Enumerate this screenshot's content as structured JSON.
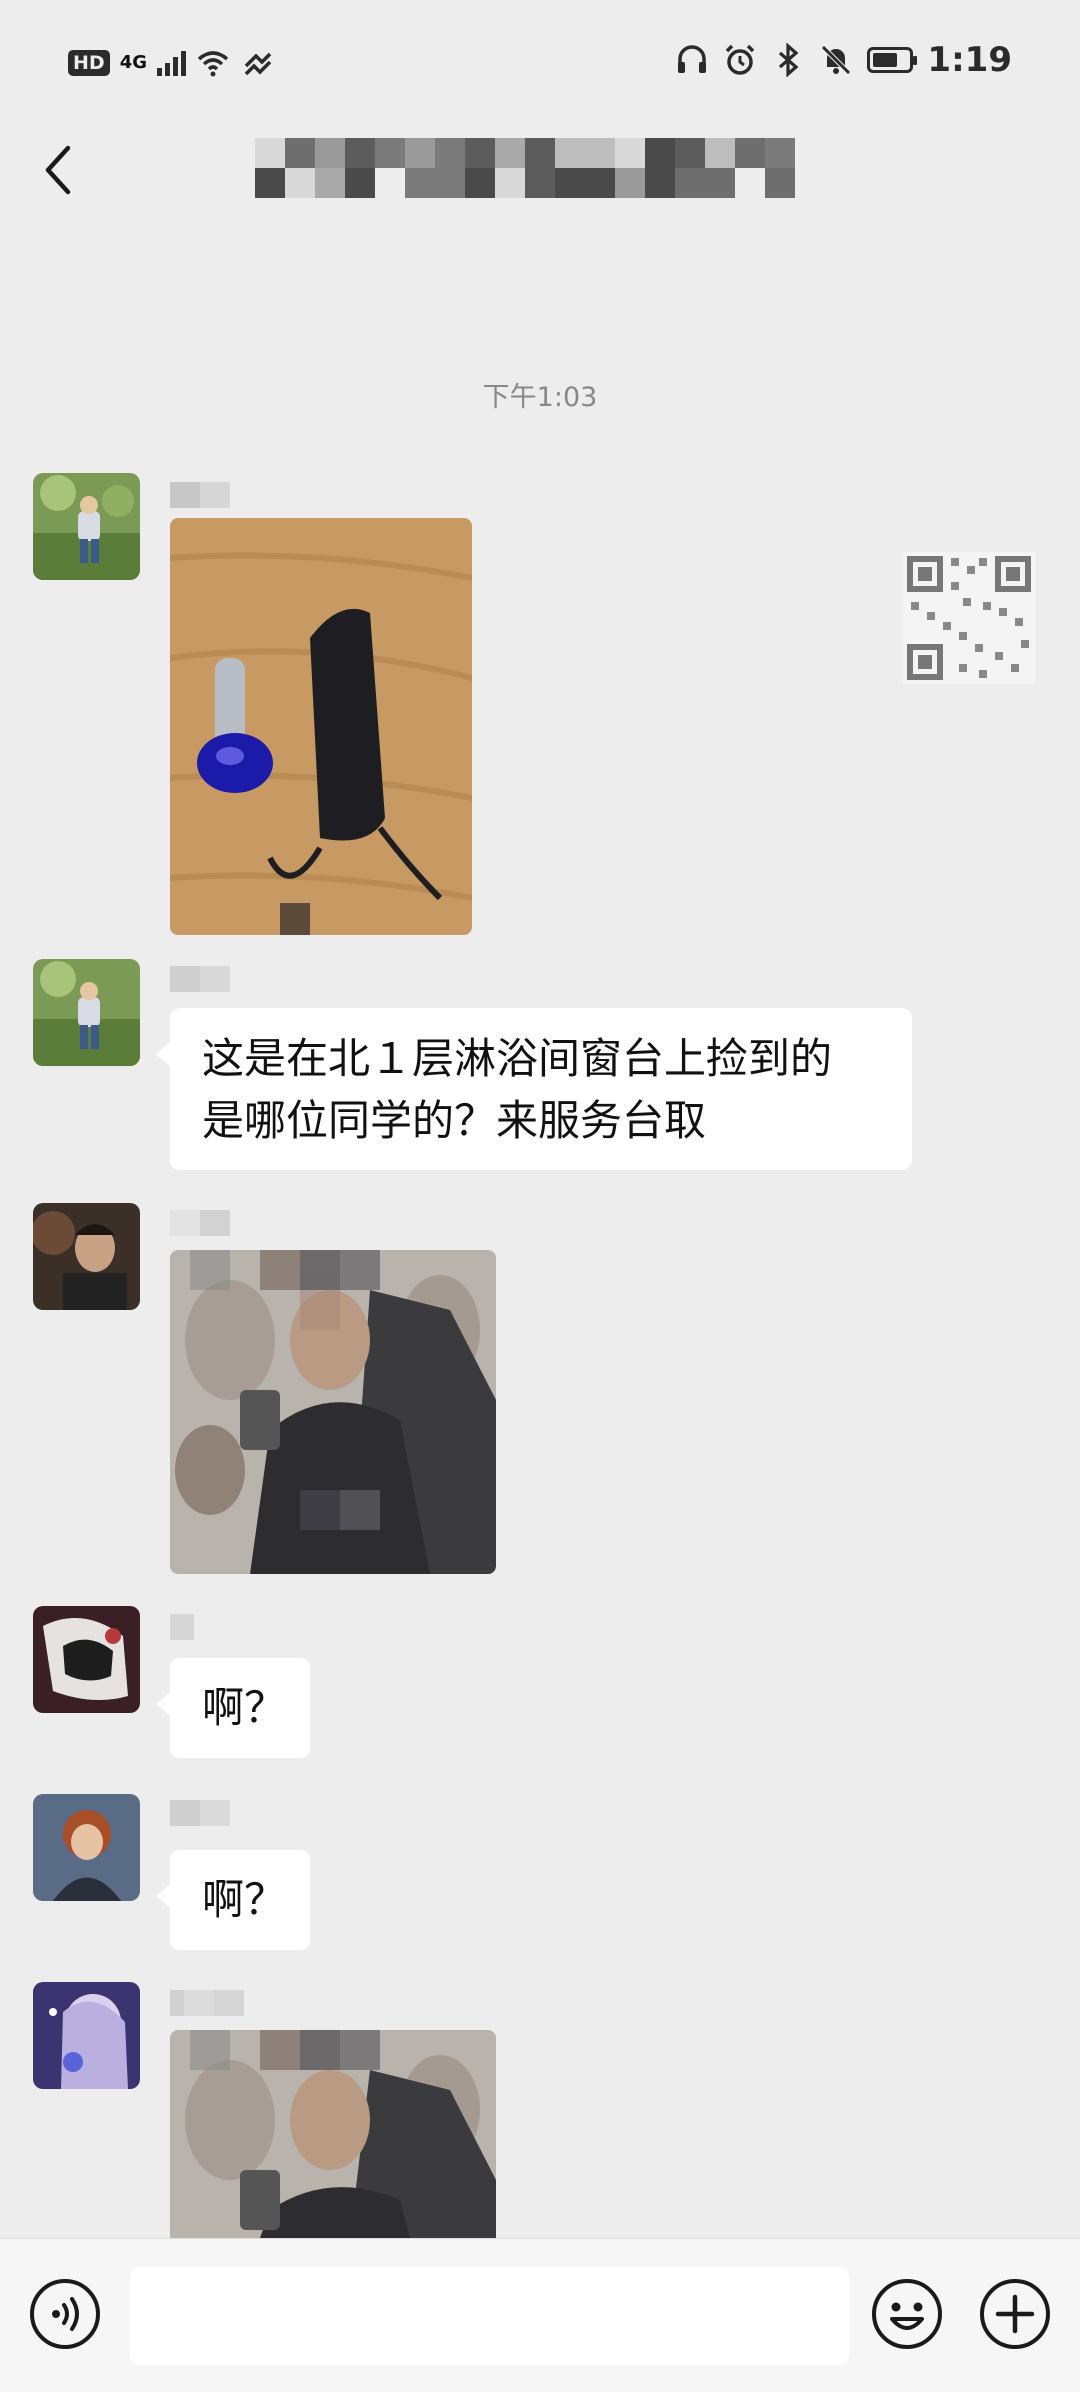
{
  "status_bar": {
    "hd_label": "HD",
    "network_label": "4G",
    "time": "1:19",
    "icons": [
      "signal-icon",
      "wifi-icon",
      "headphones-icon",
      "alarm-icon",
      "bluetooth-icon",
      "mute-icon",
      "battery-icon"
    ]
  },
  "header": {
    "title": ""
  },
  "chat": {
    "timestamp": "下午1:03",
    "messages": [
      {
        "type": "image",
        "description_icon": "photo"
      },
      {
        "type": "text",
        "line1": "这是在北１层淋浴间窗台上捡到的",
        "line2": "是哪位同学的？来服务台取"
      },
      {
        "type": "image",
        "description_icon": "photo"
      },
      {
        "type": "text",
        "text": "啊？"
      },
      {
        "type": "text",
        "text": "啊？"
      },
      {
        "type": "image",
        "description_icon": "photo"
      }
    ]
  },
  "input_bar": {
    "placeholder": ""
  },
  "colors": {
    "background": "#ededed",
    "bubble": "#ffffff",
    "timestamp": "#888888"
  }
}
